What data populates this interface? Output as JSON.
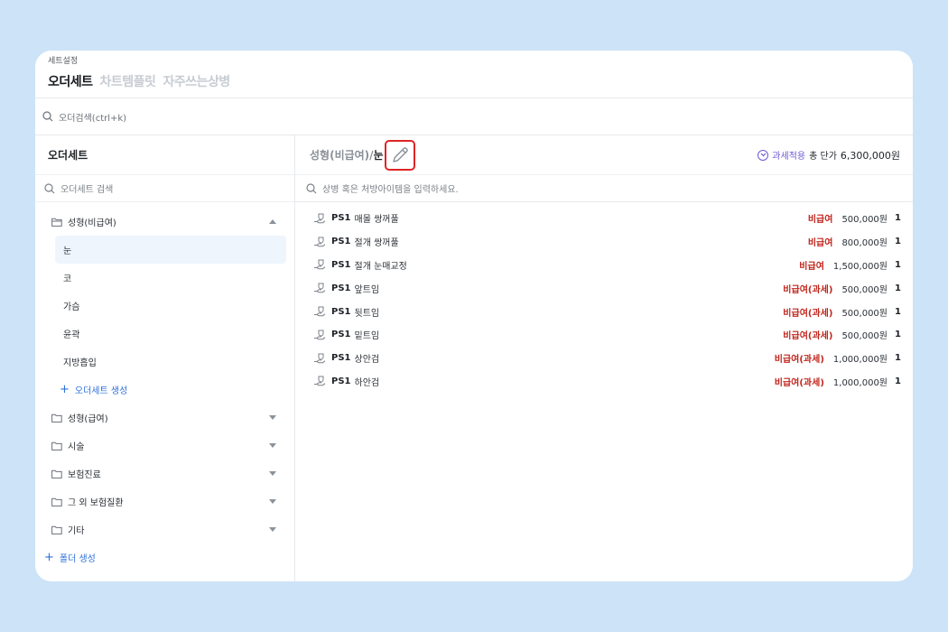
{
  "breadcrumb": "세트설정",
  "tabs": [
    {
      "label": "오더세트",
      "active": true
    },
    {
      "label": "차트템플릿",
      "active": false
    },
    {
      "label": "자주쓰는상병",
      "active": false
    }
  ],
  "order_search": {
    "placeholder": "오더검색(ctrl+k)"
  },
  "sidebar": {
    "title": "오더세트",
    "search_placeholder": "오더세트 검색",
    "open_folder": {
      "name": "성형(비급여)",
      "items": [
        "눈",
        "코",
        "가슴",
        "윤곽",
        "지방흡입"
      ],
      "selected": "눈",
      "add_label": "오더세트 생성"
    },
    "folders": [
      "성형(급여)",
      "시술",
      "보험진료",
      "그 외 보험질환",
      "기타"
    ],
    "add_folder_label": "폴더 생성"
  },
  "main": {
    "path_prefix": "성형(비급여)/",
    "path_current": "눈",
    "tax_label": "과세적용",
    "total_label": "총 단가",
    "total_value": "6,300,000원",
    "search_placeholder": "상병 혹은 처방아이템을 입력하세요.",
    "rows": [
      {
        "code": "PS1",
        "name": "매몰 쌍꺼풀",
        "type": "비급여",
        "price": "500,000원",
        "qty": "1"
      },
      {
        "code": "PS1",
        "name": "절개 쌍꺼풀",
        "type": "비급여",
        "price": "800,000원",
        "qty": "1"
      },
      {
        "code": "PS1",
        "name": "절개 눈매교정",
        "type": "비급여",
        "price": "1,500,000원",
        "qty": "1"
      },
      {
        "code": "PS1",
        "name": "앞트임",
        "type": "비급여(과세)",
        "price": "500,000원",
        "qty": "1"
      },
      {
        "code": "PS1",
        "name": "뒷트임",
        "type": "비급여(과세)",
        "price": "500,000원",
        "qty": "1"
      },
      {
        "code": "PS1",
        "name": "밑트임",
        "type": "비급여(과세)",
        "price": "500,000원",
        "qty": "1"
      },
      {
        "code": "PS1",
        "name": "상안검",
        "type": "비급여(과세)",
        "price": "1,000,000원",
        "qty": "1"
      },
      {
        "code": "PS1",
        "name": "하안검",
        "type": "비급여(과세)",
        "price": "1,000,000원",
        "qty": "1"
      }
    ]
  },
  "colors": {
    "accent": "#2c6fd6",
    "danger": "#c0261d",
    "tax": "#6c5ad6",
    "highlight_border": "#e02424"
  }
}
